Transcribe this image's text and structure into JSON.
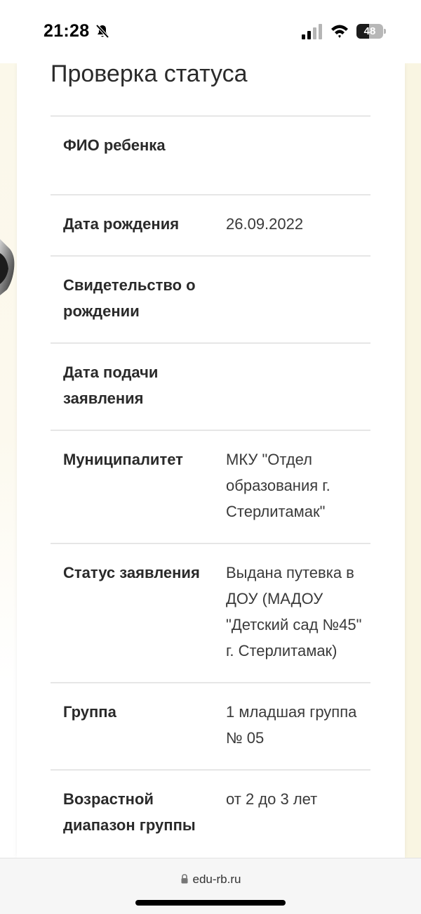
{
  "status_bar": {
    "time": "21:28",
    "battery": "48",
    "battery_level": 0.48
  },
  "page": {
    "title": "Проверка статуса"
  },
  "rows": [
    {
      "label": "ФИО ребенка",
      "value": ""
    },
    {
      "label": "Дата рождения",
      "value": "26.09.2022"
    },
    {
      "label": "Свидетельство о рождении",
      "value": ""
    },
    {
      "label": "Дата подачи заявления",
      "value": ""
    },
    {
      "label": "Муниципалитет",
      "value": "МКУ \"Отдел образования г. Стерлитамак\""
    },
    {
      "label": "Статус заявления",
      "value": "Выдана путевка в ДОУ (МАДОУ \"Детский сад №45\" г. Стерлитамак)"
    },
    {
      "label": "Группа",
      "value": "1 младшая группа № 05"
    },
    {
      "label": "Возрастной диапазон группы",
      "value": "от 2 до 3 лет"
    }
  ],
  "browser": {
    "url": "edu-rb.ru"
  }
}
